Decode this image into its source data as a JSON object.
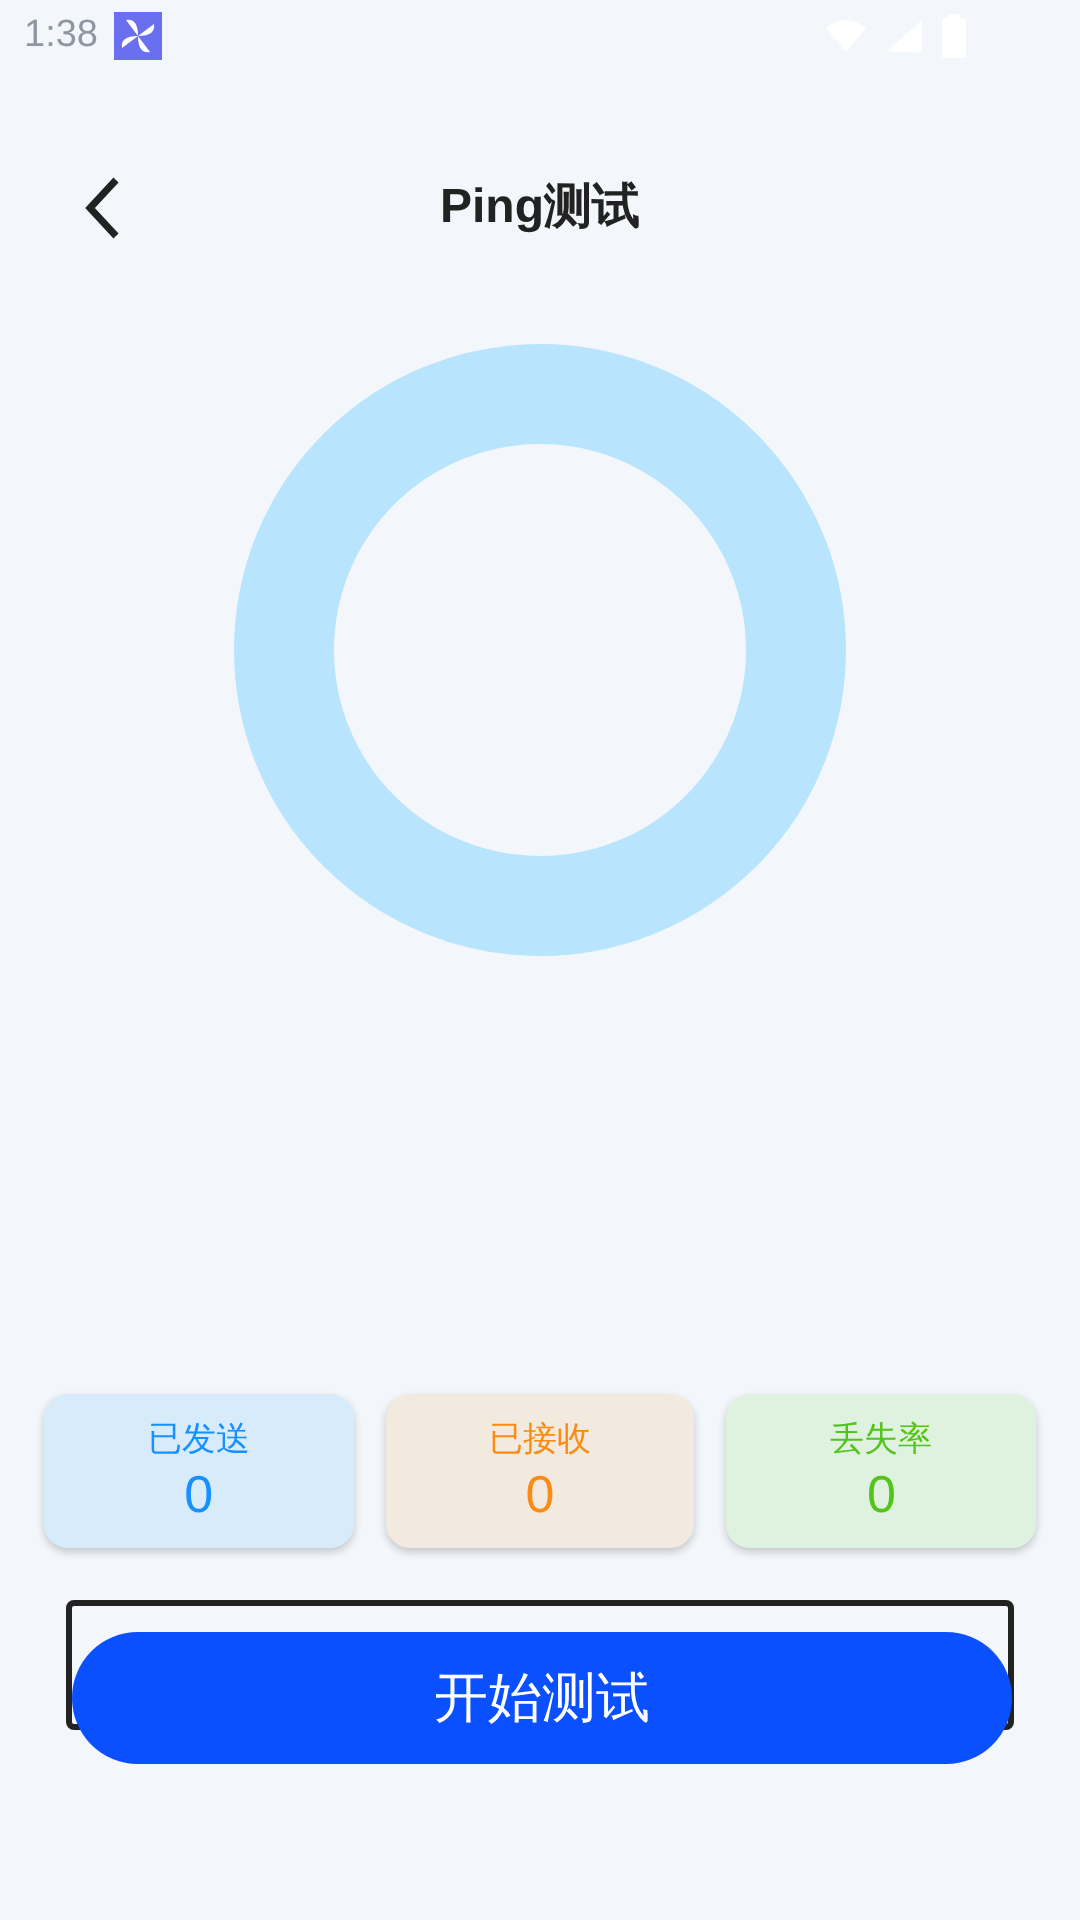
{
  "status_bar": {
    "time": "1:38"
  },
  "header": {
    "title": "Ping测试"
  },
  "stats": [
    {
      "label": "已发送",
      "value": "0",
      "color": "#1890ff"
    },
    {
      "label": "已接收",
      "value": "0",
      "color": "#fa8c16"
    },
    {
      "label": "丢失率",
      "value": "0",
      "color": "#52c41a"
    }
  ],
  "start_button": {
    "label": "开始测试"
  }
}
